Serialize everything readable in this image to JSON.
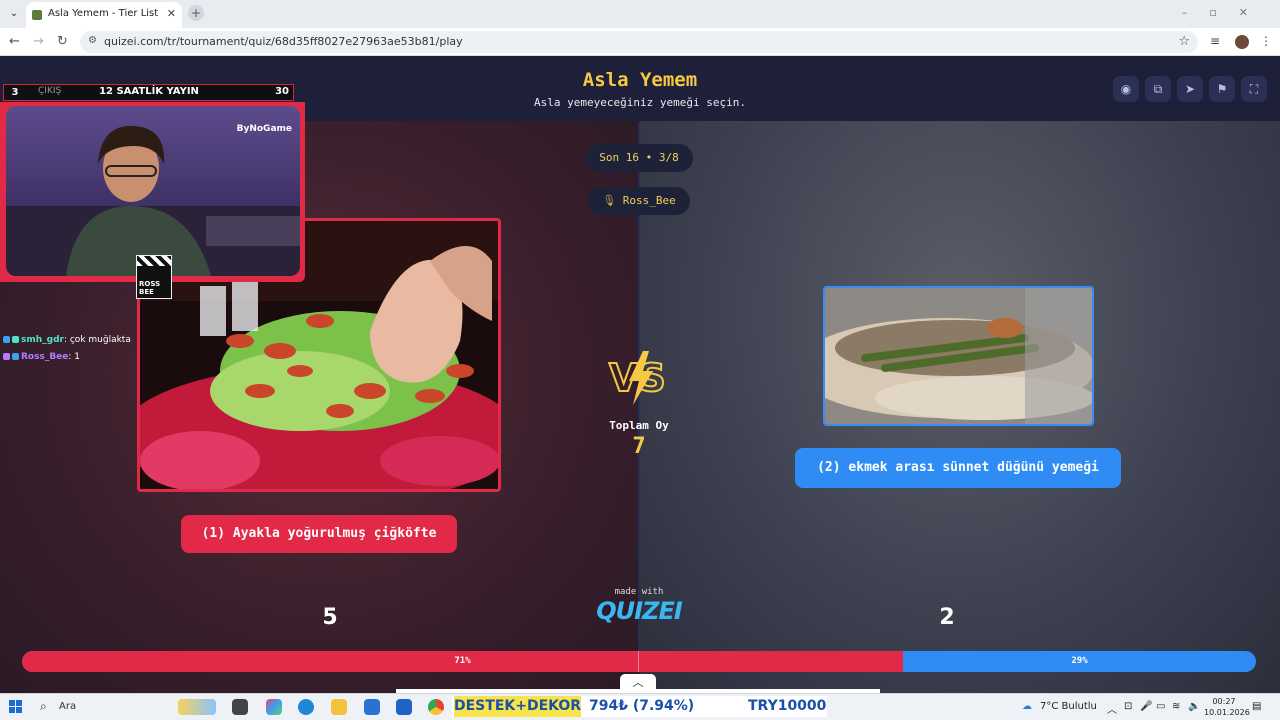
{
  "browser": {
    "tab_title": "Asla Yemem - Tier List, Kör Sıral",
    "tab_close": "✕",
    "new_tab": "+",
    "url": "quizei.com/tr/tournament/quiz/68d35ff8027e27963ae53b81/play"
  },
  "page": {
    "title": "Asla Yemem",
    "subtitle": "Asla yemeyeceğiniz yemeği seçin.",
    "round_pill": "Son 16 • 3/8",
    "user_pill": "Ross_Bee",
    "total_label": "Toplam Oy",
    "total_votes": "7",
    "left_option": {
      "label": "(1) Ayakla yoğurulmuş çiğköfte",
      "votes": "5",
      "percent": "71%",
      "share": 0.71
    },
    "right_option": {
      "label": "(2) ekmek arası sünnet düğünü yemeği",
      "votes": "2",
      "percent": "29%"
    },
    "made_with": "made with",
    "brand": "QUIZEI",
    "colors": {
      "accent": "#f6c843",
      "left": "#e32948",
      "right": "#2f8cf5"
    }
  },
  "overlay": {
    "left_num": "3",
    "exit_label": "ÇIKIŞ",
    "stream_title": "12 SAATLİK YAYIN",
    "right_num": "30",
    "cam_brand": "ByNoGame",
    "clap_text_1": "ROSS",
    "clap_text_2": "BEE",
    "chat": [
      {
        "user": "smh_gdr",
        "msg": ": çok muğlakta"
      },
      {
        "user": "Ross_Bee",
        "msg": ": 1"
      }
    ]
  },
  "taskbar": {
    "search": "Ara",
    "ticker_1": "DESTEK+DEKOR",
    "ticker_2": "794₺ (7.94%)",
    "ticker_3": "TRY10000",
    "weather": "7°C Bulutlu",
    "time": "00:27",
    "date": "10.01.2026"
  }
}
